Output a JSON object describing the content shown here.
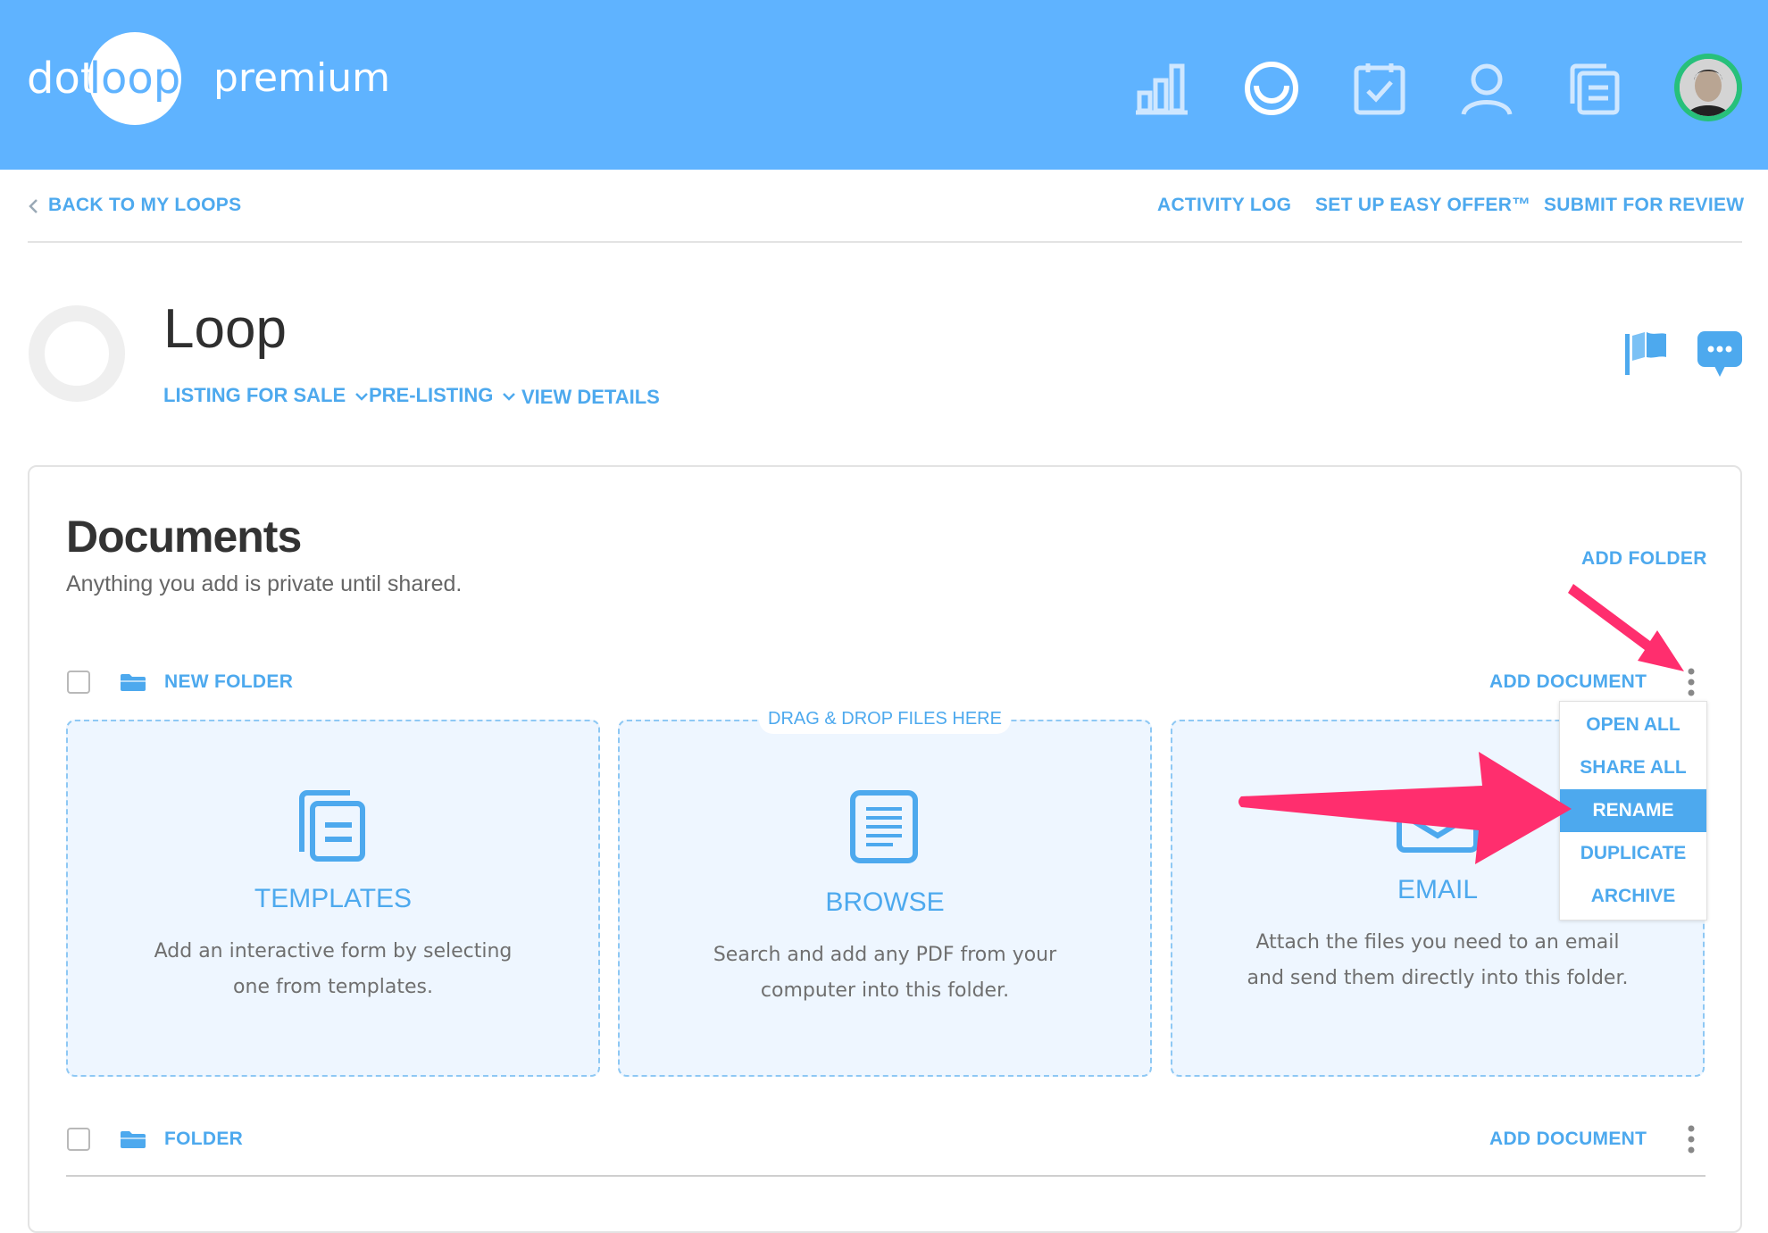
{
  "header": {
    "logo_dot": "dot",
    "logo_loop": "loop",
    "plan": "premium",
    "icons": [
      "chart-icon",
      "loop-icon",
      "tasks-icon",
      "profile-icon",
      "documents-icon"
    ]
  },
  "subnav": {
    "back": "BACK TO MY LOOPS",
    "activity_log": "ACTIVITY LOG",
    "easy_offer": "SET UP EASY OFFER™",
    "submit": "SUBMIT FOR REVIEW"
  },
  "loop": {
    "title": "Loop",
    "type": "LISTING FOR SALE",
    "status": "PRE-LISTING",
    "details": "VIEW DETAILS"
  },
  "documents": {
    "title": "Documents",
    "subtitle": "Anything you add is private until shared.",
    "add_folder": "ADD FOLDER",
    "folders": [
      {
        "name": "NEW FOLDER",
        "add_document": "ADD DOCUMENT"
      },
      {
        "name": "FOLDER",
        "add_document": "ADD DOCUMENT"
      }
    ],
    "drag_drop": "DRAG & DROP FILES HERE",
    "tiles": [
      {
        "title": "TEMPLATES",
        "line1": "Add an interactive form by selecting",
        "line2": "one from templates."
      },
      {
        "title": "BROWSE",
        "line1": "Search and add any PDF from your",
        "line2": "computer into this folder."
      },
      {
        "title": "EMAIL",
        "line1": "Attach the files you need to an email",
        "line2": "and send them directly into this folder."
      }
    ],
    "menu": {
      "items": [
        "OPEN ALL",
        "SHARE ALL",
        "RENAME",
        "DUPLICATE",
        "ARCHIVE"
      ],
      "active": "RENAME"
    }
  },
  "colors": {
    "header": "#5fb3ff",
    "link": "#4da9ee",
    "arrow": "#ff2e6e",
    "tile_bg": "#eef6ff"
  }
}
